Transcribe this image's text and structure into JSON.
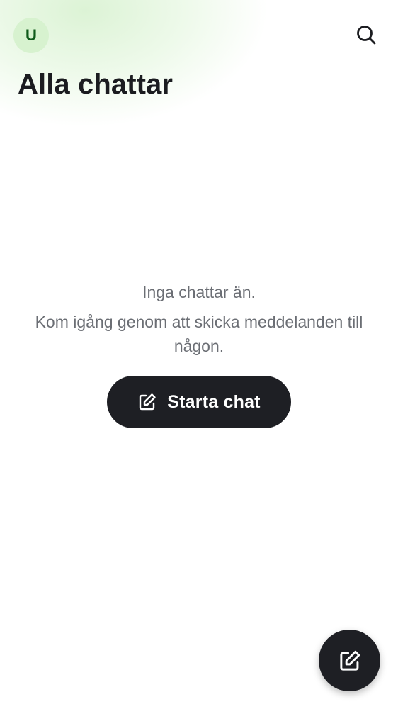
{
  "header": {
    "avatar_initial": "U",
    "title": "Alla chattar"
  },
  "empty_state": {
    "title": "Inga chattar än.",
    "subtitle": "Kom igång genom att skicka meddelanden till någon.",
    "start_button_label": "Starta chat"
  },
  "icons": {
    "search": "search-icon",
    "compose": "edit-icon",
    "fab": "edit-icon"
  },
  "colors": {
    "avatar_bg": "#d7f2cf",
    "avatar_text": "#0f5a1a",
    "button_bg": "#1e1f24",
    "muted_text": "#6b6e74"
  }
}
